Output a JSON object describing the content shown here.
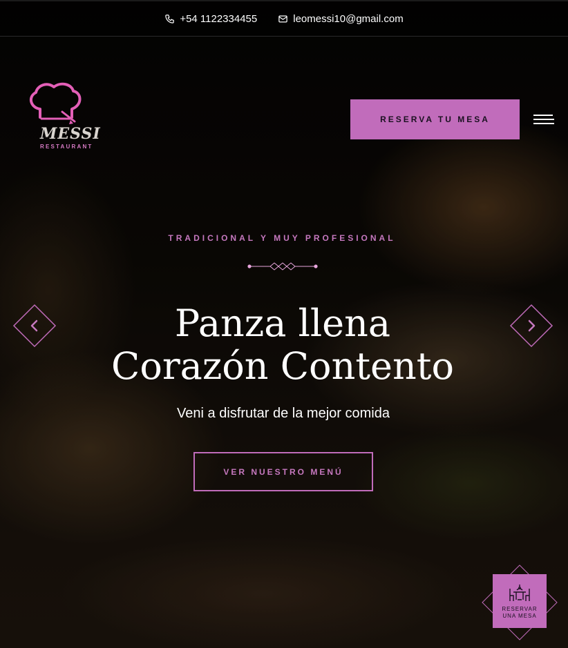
{
  "topbar": {
    "phone": "+54 1122334455",
    "phone_icon": "phone-icon",
    "email": "leomessi10@gmail.com",
    "email_icon": "mail-icon"
  },
  "logo": {
    "name": "MESSI",
    "subtitle": "RESTAURANT",
    "icon": "chef-hat-icon"
  },
  "header": {
    "reserve_label": "RESERVA TU MESA",
    "menu_icon": "hamburger-menu-icon"
  },
  "hero": {
    "eyebrow": "TRADICIONAL Y MUY PROFESIONAL",
    "title_line1": "Panza llena",
    "title_line2": "Corazón Contento",
    "subtitle": "Veni a disfrutar de la mejor comida",
    "cta_label": "VER NUESTRO MENÚ"
  },
  "slider": {
    "prev_icon": "chevron-left-icon",
    "next_icon": "chevron-right-icon"
  },
  "floating_widget": {
    "line1": "RESERVAR",
    "line2": "UNA MESA",
    "icon": "dining-table-icon"
  },
  "colors": {
    "accent": "#c16cbb",
    "accent_text": "#c678bf",
    "background": "#000000"
  }
}
